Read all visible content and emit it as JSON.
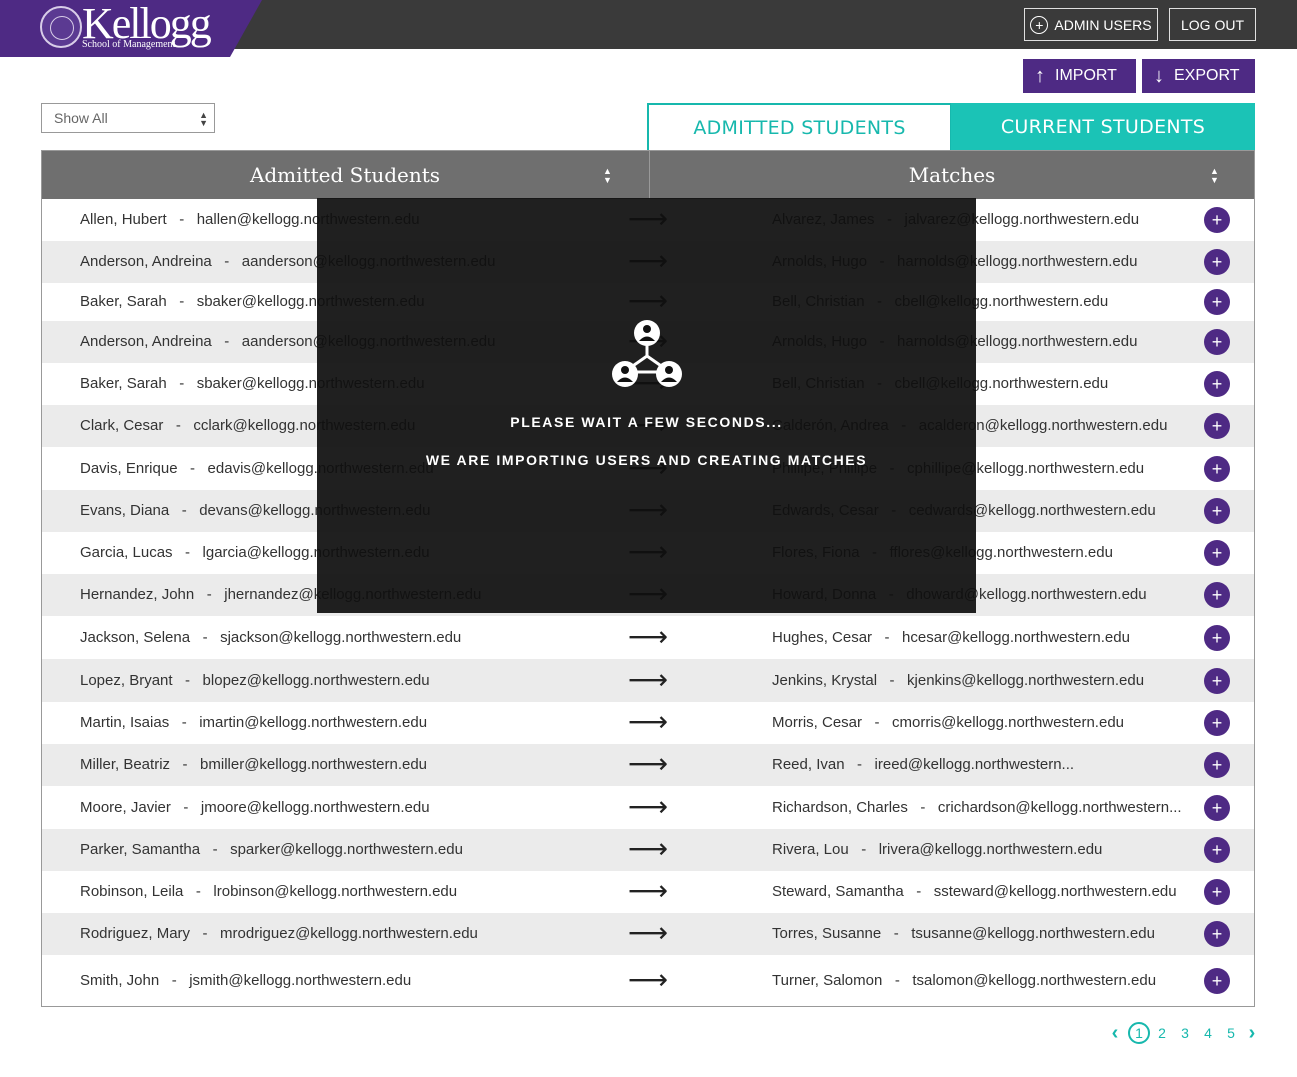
{
  "header": {
    "logo_word": "Kellogg",
    "logo_sub": "School of Management",
    "admin_users_label": "ADMIN USERS",
    "logout_label": "LOG OUT"
  },
  "toolbar": {
    "import_label": "IMPORT",
    "export_label": "EXPORT",
    "filter_value": "Show All"
  },
  "tabs": [
    {
      "label": "ADMITTED STUDENTS"
    },
    {
      "label": "CURRENT STUDENTS"
    }
  ],
  "table": {
    "col_admitted": "Admitted Students",
    "col_matches": "Matches",
    "rows": [
      {
        "left": "Allen, Hubert   -   hallen@kellogg.northwestern.edu",
        "right": "Alvarez, James   -   jalvarez@kellogg.northwestern.edu"
      },
      {
        "left": "Anderson, Andreina   -   aanderson@kellogg.northwestern.edu",
        "right": "Arnolds, Hugo   -   harnolds@kellogg.northwestern.edu"
      },
      {
        "left": "Baker, Sarah   -   sbaker@kellogg.northwestern.edu",
        "right": "Bell, Christian   -   cbell@kellogg.northwestern.edu"
      },
      {
        "left": "Anderson, Andreina   -   aanderson@kellogg.northwestern.edu",
        "right": "Arnolds, Hugo   -   harnolds@kellogg.northwestern.edu"
      },
      {
        "left": "Baker, Sarah   -   sbaker@kellogg.northwestern.edu",
        "right": "Bell, Christian   -   cbell@kellogg.northwestern.edu"
      },
      {
        "left": "Clark, Cesar   -   cclark@kellogg.northwestern.edu",
        "right": "Calderón, Andrea   -   acalderon@kellogg.northwestern.edu"
      },
      {
        "left": "Davis, Enrique   -   edavis@kellogg.northwestern.edu",
        "right": "Phillipe, Phillipe   -   cphillipe@kellogg.northwestern.edu"
      },
      {
        "left": "Evans, Diana   -   devans@kellogg.northwestern.edu",
        "right": "Edwards, Cesar   -   cedwards@kellogg.northwestern.edu"
      },
      {
        "left": "Garcia, Lucas   -   lgarcia@kellogg.northwestern.edu",
        "right": "Flores, Fiona   -   fflores@kellogg.northwestern.edu"
      },
      {
        "left": "Hernandez, John   -   jhernandez@kellogg.northwestern.edu",
        "right": "Howard, Donna   -   dhoward@kellogg.northwestern.edu"
      },
      {
        "left": "Jackson, Selena   -   sjackson@kellogg.northwestern.edu",
        "right": "Hughes, Cesar   -   hcesar@kellogg.northwestern.edu"
      },
      {
        "left": "Lopez, Bryant   -   blopez@kellogg.northwestern.edu",
        "right": "Jenkins, Krystal   -   kjenkins@kellogg.northwestern.edu"
      },
      {
        "left": "Martin, Isaias   -   imartin@kellogg.northwestern.edu",
        "right": "Morris, Cesar   -   cmorris@kellogg.northwestern.edu"
      },
      {
        "left": "Miller, Beatriz   -   bmiller@kellogg.northwestern.edu",
        "right": "Reed, Ivan   -   ireed@kellogg.northwestern..."
      },
      {
        "left": "Moore, Javier   -   jmoore@kellogg.northwestern.edu",
        "right": "Richardson, Charles   -   crichardson@kellogg.northwestern..."
      },
      {
        "left": "Parker, Samantha   -   sparker@kellogg.northwestern.edu",
        "right": "Rivera, Lou   -   lrivera@kellogg.northwestern.edu"
      },
      {
        "left": "Robinson, Leila   -   lrobinson@kellogg.northwestern.edu",
        "right": "Steward, Samantha   -   ssteward@kellogg.northwestern.edu"
      },
      {
        "left": "Rodriguez, Mary   -   mrodriguez@kellogg.northwestern.edu",
        "right": "Torres, Susanne   -   tsusanne@kellogg.northwestern.edu"
      },
      {
        "left": "Smith, John   -   jsmith@kellogg.northwestern.edu",
        "right": "Turner, Salomon   -   tsalomon@kellogg.northwestern.edu"
      }
    ]
  },
  "overlay": {
    "line1": "PLEASE WAIT A FEW SECONDS...",
    "line2": "WE ARE IMPORTING USERS AND CREATING MATCHES"
  },
  "pagination": {
    "pages": [
      "1",
      "2",
      "3",
      "4",
      "5"
    ],
    "current": "1"
  },
  "colors": {
    "brand_purple": "#4e2a84",
    "teal": "#1bc3b6",
    "header_gray": "#6f6f6f",
    "topbar": "#3a3a3a"
  }
}
